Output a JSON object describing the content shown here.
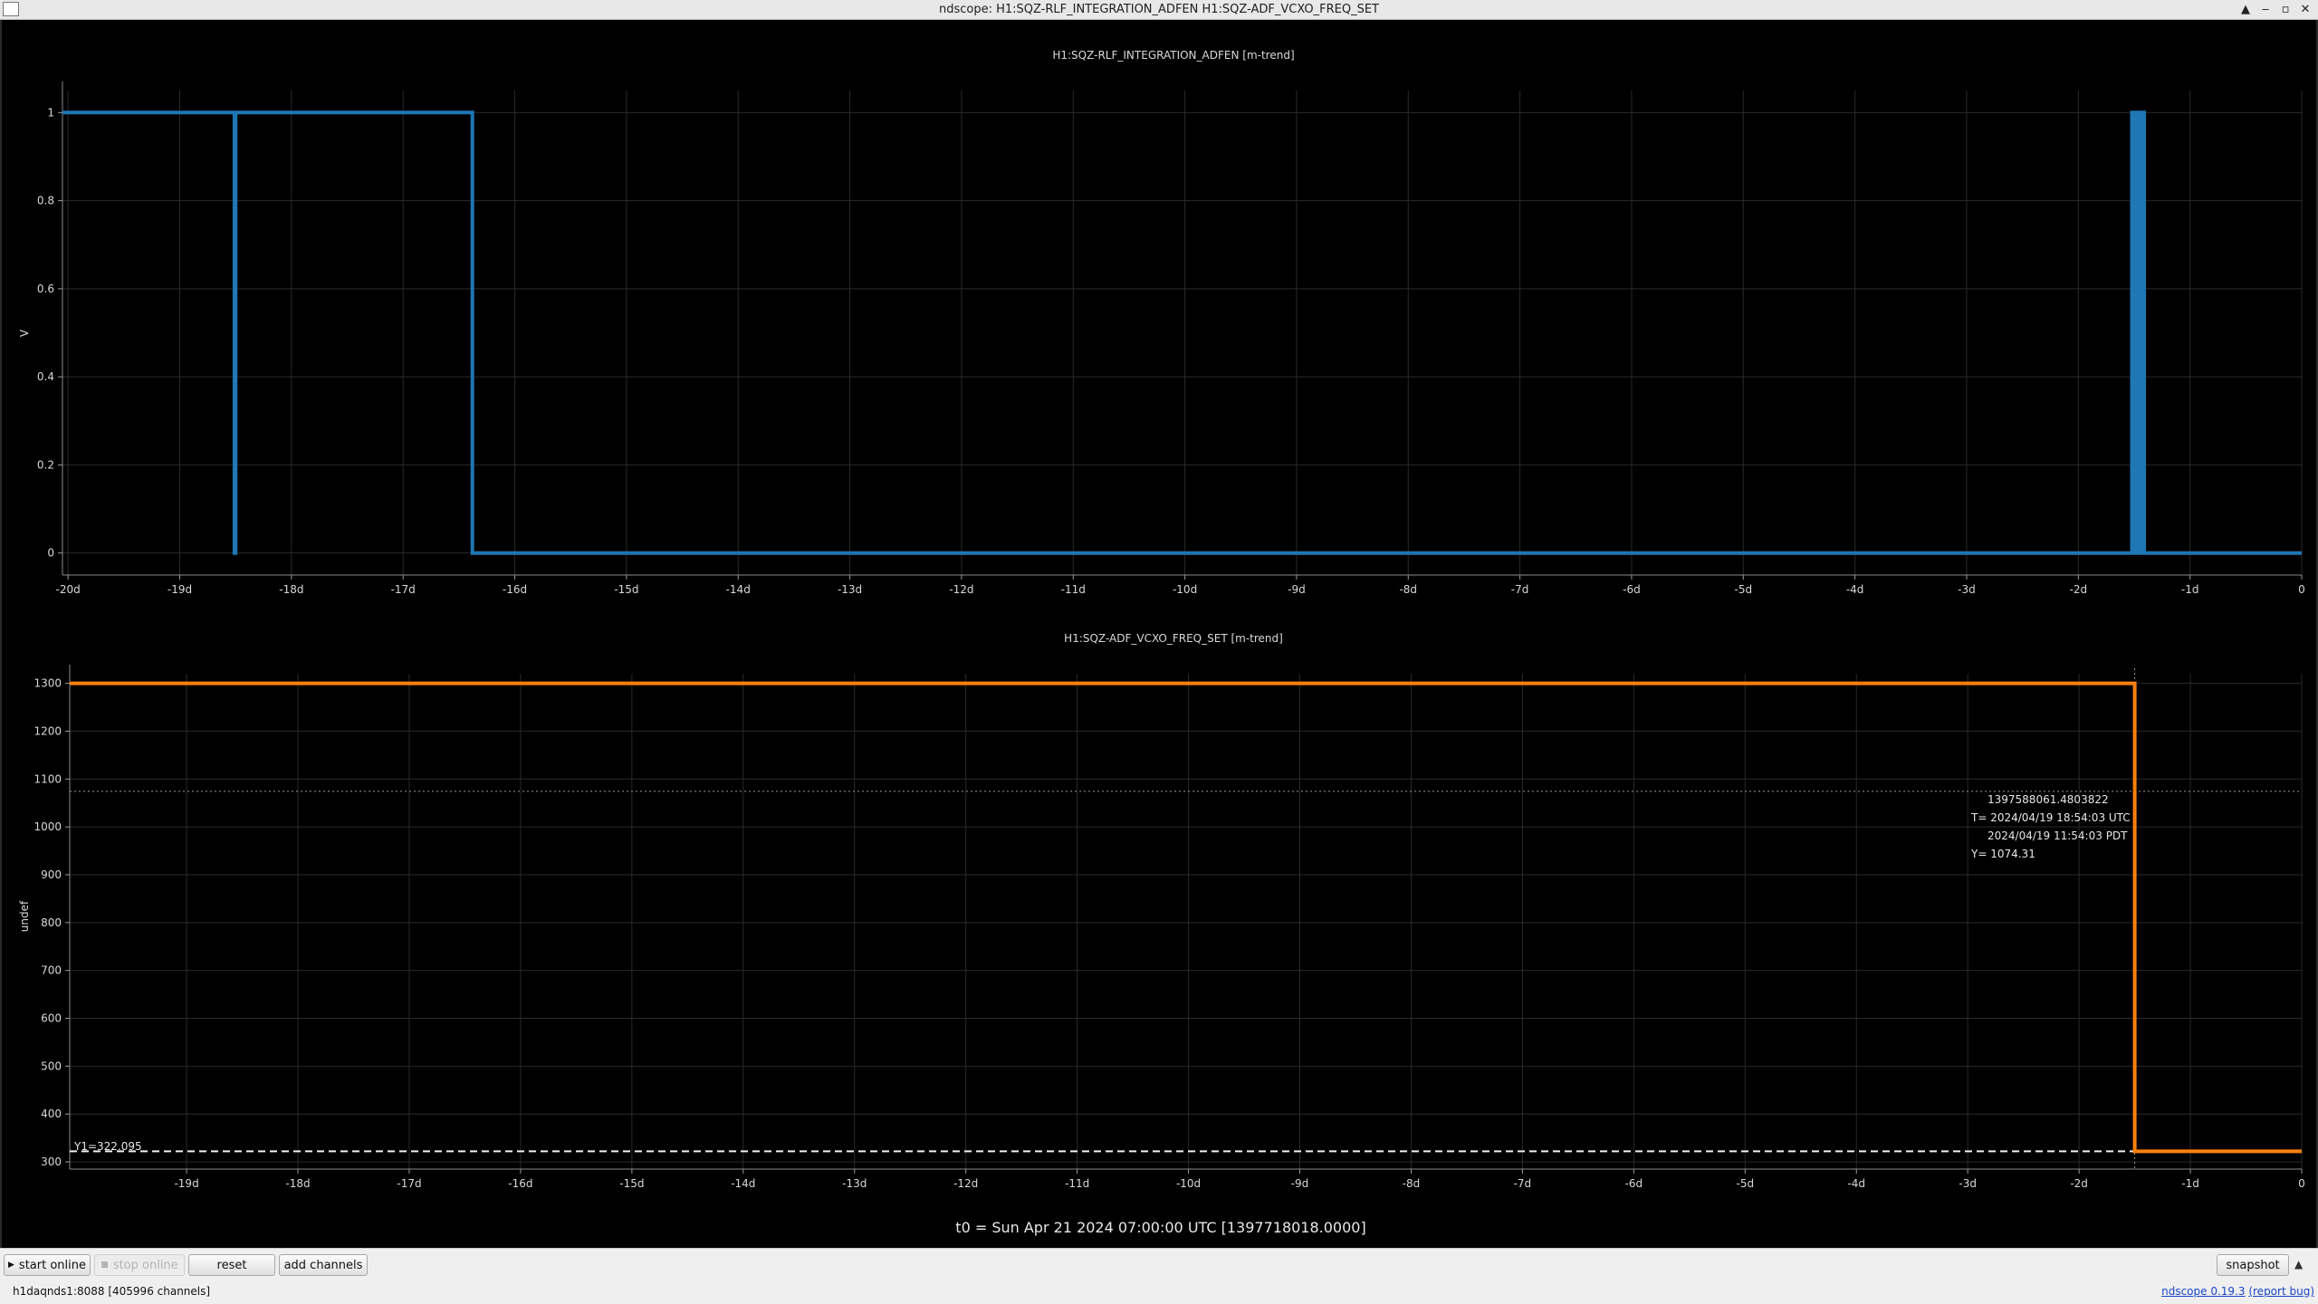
{
  "window": {
    "title": "ndscope: H1:SQZ-RLF_INTEGRATION_ADFEN H1:SQZ-ADF_VCXO_FREQ_SET",
    "controls": [
      "▲",
      "‒",
      "▫",
      "✕"
    ]
  },
  "plot1": {
    "title": "H1:SQZ-RLF_INTEGRATION_ADFEN [m-trend]",
    "ylabel": "V",
    "line_color": "#1f77b4"
  },
  "plot2": {
    "title": "H1:SQZ-ADF_VCXO_FREQ_SET [m-trend]",
    "ylabel": "undef",
    "line_color": "#ff7f0e"
  },
  "cursor": {
    "gps": "1397588061.4803822",
    "utc": "T= 2024/04/19 18:54:03 UTC",
    "pdt": "2024/04/19 11:54:03 PDT",
    "y": "Y= 1074.31",
    "y1_label": "Y1=322.095"
  },
  "t0_label": "t0 = Sun Apr 21 2024 07:00:00 UTC [1397718018.0000]",
  "chart_data": [
    {
      "type": "line",
      "title": "H1:SQZ-RLF_INTEGRATION_ADFEN [m-trend]",
      "ylabel": "V",
      "xlim": [
        -20.05,
        0
      ],
      "ylim": [
        -0.05,
        1.05
      ],
      "x_unit": "days",
      "x_ticks": [
        -20,
        -19,
        -18,
        -17,
        -16,
        -15,
        -14,
        -13,
        -12,
        -11,
        -10,
        -9,
        -8,
        -7,
        -6,
        -5,
        -4,
        -3,
        -2,
        -1,
        0
      ],
      "x_tick_labels": [
        "-20d",
        "-19d",
        "-18d",
        "-17d",
        "-16d",
        "-15d",
        "-14d",
        "-13d",
        "-12d",
        "-11d",
        "-10d",
        "-9d",
        "-8d",
        "-7d",
        "-6d",
        "-5d",
        "-4d",
        "-3d",
        "-2d",
        "-1d",
        "0"
      ],
      "y_ticks": [
        0,
        0.2,
        0.4,
        0.6,
        0.8,
        1
      ],
      "y_tick_labels": [
        "0",
        "0.2",
        "0.4",
        "0.6",
        "0.8",
        "1"
      ],
      "grid": true,
      "series": [
        {
          "color": "#1f77b4",
          "x": [
            -20.05,
            -18.51,
            -18.51,
            -18.5,
            -18.5,
            -16.38,
            -16.38,
            -1.52,
            -1.52,
            -1.5,
            -1.5,
            -1.48,
            -1.48,
            -1.46,
            -1.46,
            -1.43,
            -1.43,
            -1.41,
            -1.41,
            0
          ],
          "y": [
            1,
            1,
            0,
            0,
            1,
            1,
            0,
            0,
            1,
            1,
            0,
            0,
            1,
            1,
            0,
            0,
            1,
            1,
            0,
            0
          ]
        }
      ]
    },
    {
      "type": "line",
      "title": "H1:SQZ-ADF_VCXO_FREQ_SET [m-trend]",
      "ylabel": "undef",
      "xlim": [
        -20.05,
        0
      ],
      "ylim": [
        285,
        1320
      ],
      "x_unit": "days",
      "x_ticks": [
        -19,
        -18,
        -17,
        -16,
        -15,
        -14,
        -13,
        -12,
        -11,
        -10,
        -9,
        -8,
        -7,
        -6,
        -5,
        -4,
        -3,
        -2,
        -1,
        0
      ],
      "x_tick_labels": [
        "-19d",
        "-18d",
        "-17d",
        "-16d",
        "-15d",
        "-14d",
        "-13d",
        "-12d",
        "-11d",
        "-10d",
        "-9d",
        "-8d",
        "-7d",
        "-6d",
        "-5d",
        "-4d",
        "-3d",
        "-2d",
        "-1d",
        "0"
      ],
      "y_ticks": [
        300,
        400,
        500,
        600,
        700,
        800,
        900,
        1000,
        1100,
        1200,
        1300
      ],
      "y_tick_labels": [
        "300",
        "400",
        "500",
        "600",
        "700",
        "800",
        "900",
        "1000",
        "1100",
        "1200",
        "1300"
      ],
      "grid": true,
      "series": [
        {
          "color": "#ff7f0e",
          "x": [
            -20.05,
            -1.5,
            -1.5,
            0
          ],
          "y": [
            1300,
            1300,
            322.1,
            322.1
          ]
        }
      ],
      "cursor_x": -1.5,
      "cursor_y": 1074.31,
      "reference_y1": 322.095
    }
  ],
  "toolbar": {
    "start_online": "start online",
    "stop_online": "stop online",
    "reset": "reset",
    "add_channels": "add channels",
    "snapshot": "snapshot",
    "expand": "▲"
  },
  "status": {
    "server": "h1daqnds1:8088  [405996 channels]",
    "version_link": "ndscope 0.19.3",
    "report_bug": "(report bug)"
  }
}
